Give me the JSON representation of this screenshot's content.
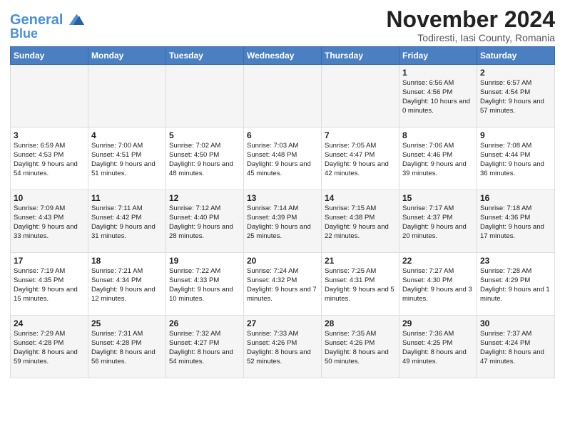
{
  "logo": {
    "line1": "General",
    "line2": "Blue"
  },
  "title": "November 2024",
  "subtitle": "Todiresti, Iasi County, Romania",
  "days_of_week": [
    "Sunday",
    "Monday",
    "Tuesday",
    "Wednesday",
    "Thursday",
    "Friday",
    "Saturday"
  ],
  "weeks": [
    [
      {
        "day": "",
        "sunrise": "",
        "sunset": "",
        "daylight": ""
      },
      {
        "day": "",
        "sunrise": "",
        "sunset": "",
        "daylight": ""
      },
      {
        "day": "",
        "sunrise": "",
        "sunset": "",
        "daylight": ""
      },
      {
        "day": "",
        "sunrise": "",
        "sunset": "",
        "daylight": ""
      },
      {
        "day": "",
        "sunrise": "",
        "sunset": "",
        "daylight": ""
      },
      {
        "day": "1",
        "sunrise": "Sunrise: 6:56 AM",
        "sunset": "Sunset: 4:56 PM",
        "daylight": "Daylight: 10 hours and 0 minutes."
      },
      {
        "day": "2",
        "sunrise": "Sunrise: 6:57 AM",
        "sunset": "Sunset: 4:54 PM",
        "daylight": "Daylight: 9 hours and 57 minutes."
      }
    ],
    [
      {
        "day": "3",
        "sunrise": "Sunrise: 6:59 AM",
        "sunset": "Sunset: 4:53 PM",
        "daylight": "Daylight: 9 hours and 54 minutes."
      },
      {
        "day": "4",
        "sunrise": "Sunrise: 7:00 AM",
        "sunset": "Sunset: 4:51 PM",
        "daylight": "Daylight: 9 hours and 51 minutes."
      },
      {
        "day": "5",
        "sunrise": "Sunrise: 7:02 AM",
        "sunset": "Sunset: 4:50 PM",
        "daylight": "Daylight: 9 hours and 48 minutes."
      },
      {
        "day": "6",
        "sunrise": "Sunrise: 7:03 AM",
        "sunset": "Sunset: 4:48 PM",
        "daylight": "Daylight: 9 hours and 45 minutes."
      },
      {
        "day": "7",
        "sunrise": "Sunrise: 7:05 AM",
        "sunset": "Sunset: 4:47 PM",
        "daylight": "Daylight: 9 hours and 42 minutes."
      },
      {
        "day": "8",
        "sunrise": "Sunrise: 7:06 AM",
        "sunset": "Sunset: 4:46 PM",
        "daylight": "Daylight: 9 hours and 39 minutes."
      },
      {
        "day": "9",
        "sunrise": "Sunrise: 7:08 AM",
        "sunset": "Sunset: 4:44 PM",
        "daylight": "Daylight: 9 hours and 36 minutes."
      }
    ],
    [
      {
        "day": "10",
        "sunrise": "Sunrise: 7:09 AM",
        "sunset": "Sunset: 4:43 PM",
        "daylight": "Daylight: 9 hours and 33 minutes."
      },
      {
        "day": "11",
        "sunrise": "Sunrise: 7:11 AM",
        "sunset": "Sunset: 4:42 PM",
        "daylight": "Daylight: 9 hours and 31 minutes."
      },
      {
        "day": "12",
        "sunrise": "Sunrise: 7:12 AM",
        "sunset": "Sunset: 4:40 PM",
        "daylight": "Daylight: 9 hours and 28 minutes."
      },
      {
        "day": "13",
        "sunrise": "Sunrise: 7:14 AM",
        "sunset": "Sunset: 4:39 PM",
        "daylight": "Daylight: 9 hours and 25 minutes."
      },
      {
        "day": "14",
        "sunrise": "Sunrise: 7:15 AM",
        "sunset": "Sunset: 4:38 PM",
        "daylight": "Daylight: 9 hours and 22 minutes."
      },
      {
        "day": "15",
        "sunrise": "Sunrise: 7:17 AM",
        "sunset": "Sunset: 4:37 PM",
        "daylight": "Daylight: 9 hours and 20 minutes."
      },
      {
        "day": "16",
        "sunrise": "Sunrise: 7:18 AM",
        "sunset": "Sunset: 4:36 PM",
        "daylight": "Daylight: 9 hours and 17 minutes."
      }
    ],
    [
      {
        "day": "17",
        "sunrise": "Sunrise: 7:19 AM",
        "sunset": "Sunset: 4:35 PM",
        "daylight": "Daylight: 9 hours and 15 minutes."
      },
      {
        "day": "18",
        "sunrise": "Sunrise: 7:21 AM",
        "sunset": "Sunset: 4:34 PM",
        "daylight": "Daylight: 9 hours and 12 minutes."
      },
      {
        "day": "19",
        "sunrise": "Sunrise: 7:22 AM",
        "sunset": "Sunset: 4:33 PM",
        "daylight": "Daylight: 9 hours and 10 minutes."
      },
      {
        "day": "20",
        "sunrise": "Sunrise: 7:24 AM",
        "sunset": "Sunset: 4:32 PM",
        "daylight": "Daylight: 9 hours and 7 minutes."
      },
      {
        "day": "21",
        "sunrise": "Sunrise: 7:25 AM",
        "sunset": "Sunset: 4:31 PM",
        "daylight": "Daylight: 9 hours and 5 minutes."
      },
      {
        "day": "22",
        "sunrise": "Sunrise: 7:27 AM",
        "sunset": "Sunset: 4:30 PM",
        "daylight": "Daylight: 9 hours and 3 minutes."
      },
      {
        "day": "23",
        "sunrise": "Sunrise: 7:28 AM",
        "sunset": "Sunset: 4:29 PM",
        "daylight": "Daylight: 9 hours and 1 minute."
      }
    ],
    [
      {
        "day": "24",
        "sunrise": "Sunrise: 7:29 AM",
        "sunset": "Sunset: 4:28 PM",
        "daylight": "Daylight: 8 hours and 59 minutes."
      },
      {
        "day": "25",
        "sunrise": "Sunrise: 7:31 AM",
        "sunset": "Sunset: 4:28 PM",
        "daylight": "Daylight: 8 hours and 56 minutes."
      },
      {
        "day": "26",
        "sunrise": "Sunrise: 7:32 AM",
        "sunset": "Sunset: 4:27 PM",
        "daylight": "Daylight: 8 hours and 54 minutes."
      },
      {
        "day": "27",
        "sunrise": "Sunrise: 7:33 AM",
        "sunset": "Sunset: 4:26 PM",
        "daylight": "Daylight: 8 hours and 52 minutes."
      },
      {
        "day": "28",
        "sunrise": "Sunrise: 7:35 AM",
        "sunset": "Sunset: 4:26 PM",
        "daylight": "Daylight: 8 hours and 50 minutes."
      },
      {
        "day": "29",
        "sunrise": "Sunrise: 7:36 AM",
        "sunset": "Sunset: 4:25 PM",
        "daylight": "Daylight: 8 hours and 49 minutes."
      },
      {
        "day": "30",
        "sunrise": "Sunrise: 7:37 AM",
        "sunset": "Sunset: 4:24 PM",
        "daylight": "Daylight: 8 hours and 47 minutes."
      }
    ]
  ]
}
